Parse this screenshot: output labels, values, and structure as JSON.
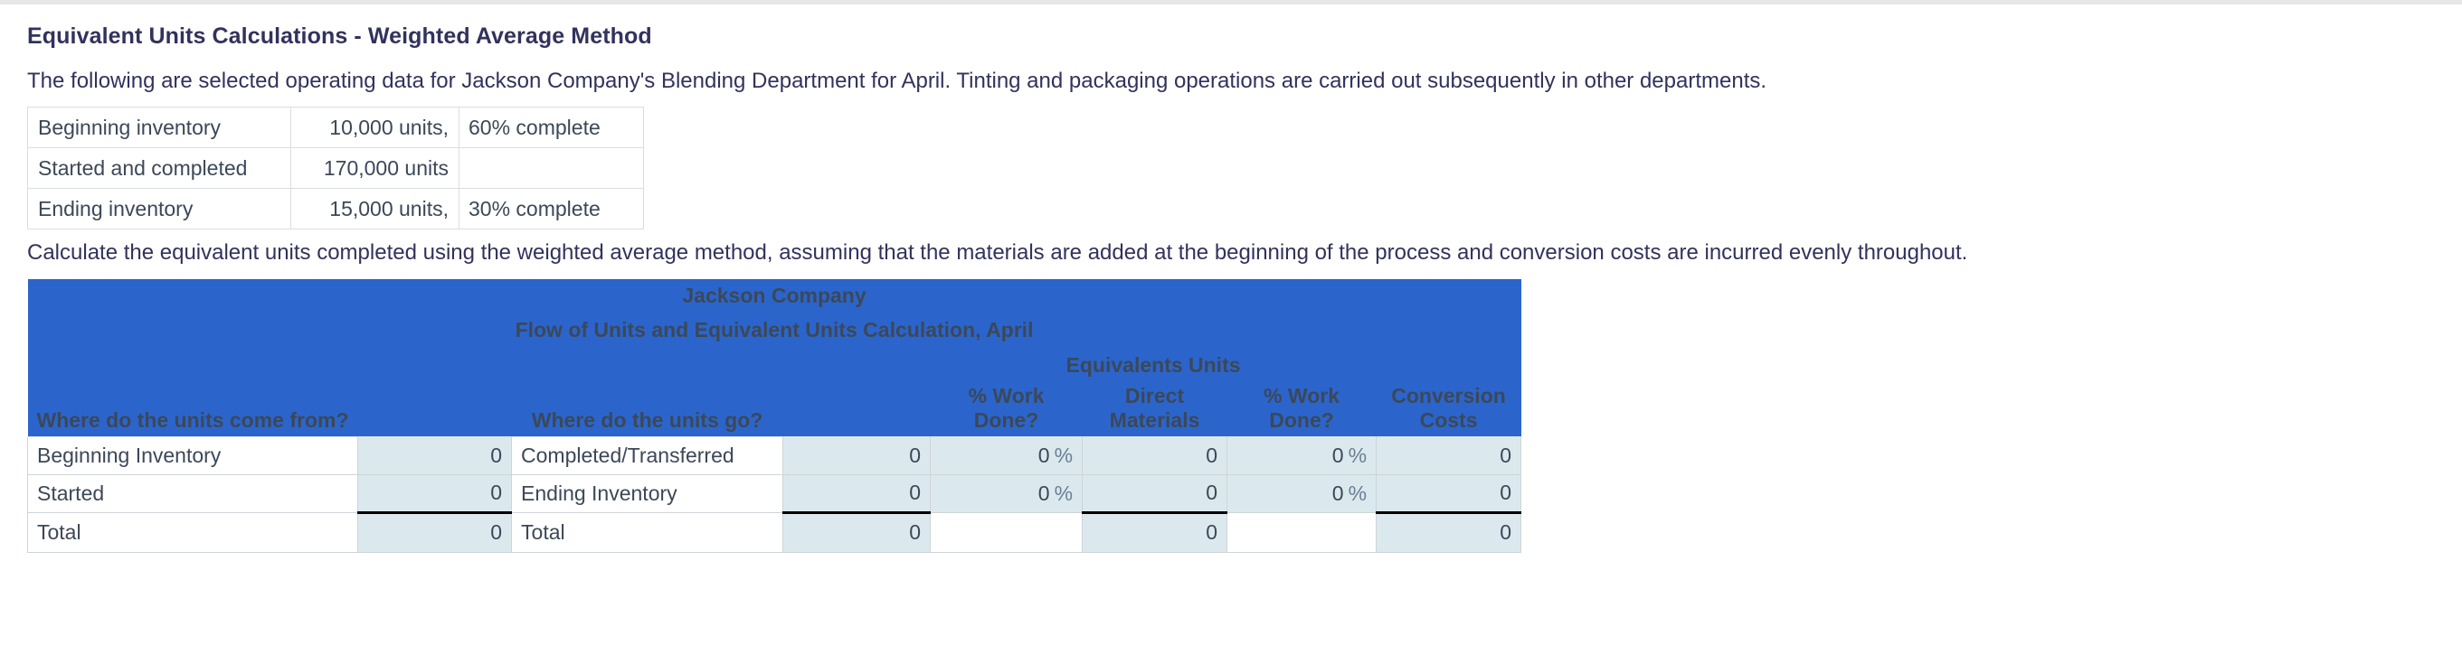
{
  "question": {
    "title": "Equivalent Units Calculations - Weighted Average Method",
    "intro": "The following are selected operating data for Jackson Company's Blending Department for April. Tinting and packaging operations are carried out subsequently in other departments.",
    "instruction": "Calculate the equivalent units completed using the weighted average method, assuming that the materials are added at the beginning of the process and conversion costs are incurred evenly throughout."
  },
  "facts_table": {
    "rows": [
      {
        "label": "Beginning inventory",
        "units": "10,000 units,",
        "pct": "60% complete"
      },
      {
        "label": "Started and completed",
        "units": "170,000 units",
        "pct": ""
      },
      {
        "label": "Ending inventory",
        "units": "15,000 units,",
        "pct": "30% complete"
      }
    ]
  },
  "sheet": {
    "company": "Jackson Company",
    "subtitle": "Flow of Units and Equivalent Units Calculation, April",
    "group_header": "Equivalents Units",
    "headers": {
      "source": "Where do the units come from?",
      "destination": "Where do the units go?",
      "work_done_1_line1": "% Work",
      "work_done_1_line2": "Done?",
      "direct_materials_line1": "Direct",
      "direct_materials_line2": "Materials",
      "work_done_2_line1": "% Work",
      "work_done_2_line2": "Done?",
      "conversion_costs_line1": "Conversion",
      "conversion_costs_line2": "Costs"
    },
    "rows": [
      {
        "source_label": "Beginning Inventory",
        "source_value": "0",
        "dest_label": "Completed/Transferred",
        "dest_value": "0",
        "work_done_1": "0",
        "work_done_1_sign": "%",
        "direct_materials": "0",
        "work_done_2": "0",
        "work_done_2_sign": "%",
        "conversion_costs": "0"
      },
      {
        "source_label": "Started",
        "source_value": "0",
        "dest_label": "Ending Inventory",
        "dest_value": "0",
        "work_done_1": "0",
        "work_done_1_sign": "%",
        "direct_materials": "0",
        "work_done_2": "0",
        "work_done_2_sign": "%",
        "conversion_costs": "0"
      },
      {
        "source_label": "Total",
        "source_value": "0",
        "dest_label": "Total",
        "dest_value": "0",
        "work_done_1": "",
        "work_done_1_sign": "",
        "direct_materials": "0",
        "work_done_2": "",
        "work_done_2_sign": "",
        "conversion_costs": "0"
      }
    ]
  },
  "colors": {
    "header_blue": "#2b65cb",
    "input_cell": "#dbe9ef",
    "text": "#32325d",
    "cell_border": "#cfd4d8"
  }
}
